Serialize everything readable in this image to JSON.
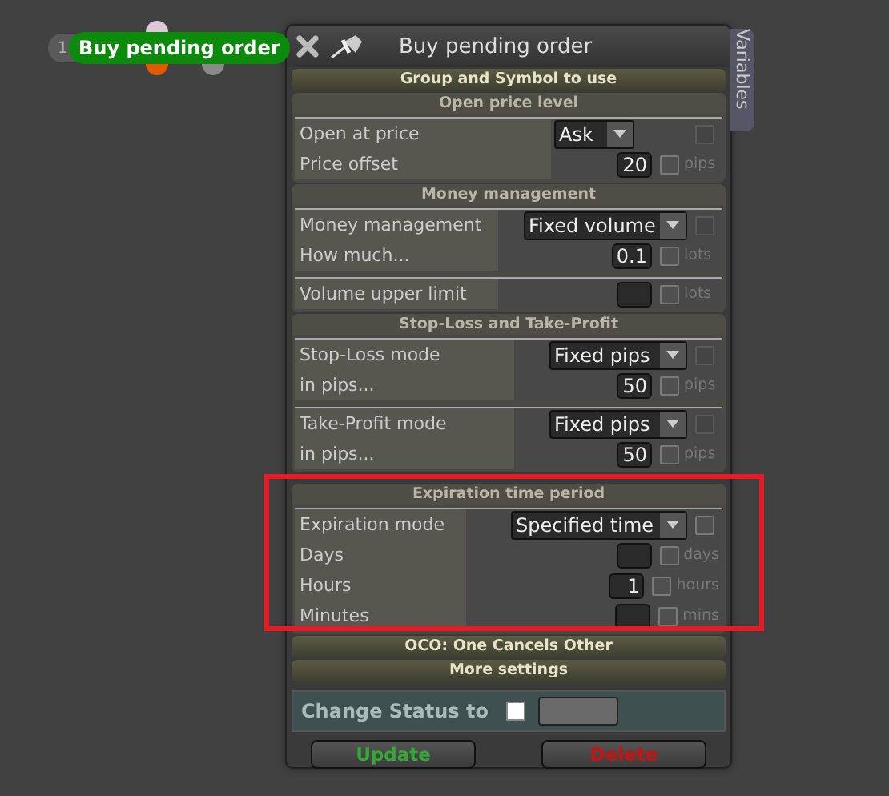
{
  "node": {
    "number": "1",
    "label": "Buy pending order"
  },
  "window": {
    "title": "Buy pending order",
    "side_tab": "Variables"
  },
  "groups": [
    {
      "title": "Group and Symbol to use",
      "expanded": false
    },
    {
      "title": "Open price level",
      "expanded": true,
      "blocks": [
        [
          {
            "kind": "select",
            "label": "Open at price",
            "value": "Ask",
            "checked": false,
            "disabled": true
          },
          {
            "kind": "number",
            "label": "Price offset",
            "value": "20",
            "unit": "pips",
            "checked": false
          }
        ]
      ]
    },
    {
      "title": "Money management",
      "expanded": true,
      "blocks": [
        [
          {
            "kind": "select",
            "label": "Money management",
            "value": "Fixed volume",
            "checked": false,
            "disabled": true
          },
          {
            "kind": "number",
            "label": "How much...",
            "value": "0.1",
            "unit": "lots",
            "checked": false
          }
        ],
        [
          {
            "kind": "number",
            "label": "Volume upper limit",
            "unit": "lots",
            "checked": false
          }
        ]
      ]
    },
    {
      "title": "Stop-Loss and Take-Profit",
      "expanded": true,
      "blocks": [
        [
          {
            "kind": "select",
            "label": "Stop-Loss mode",
            "value": "Fixed pips",
            "checked": false,
            "disabled": true
          },
          {
            "kind": "number",
            "label": "in pips...",
            "value": "50",
            "unit": "pips",
            "checked": false
          }
        ],
        [
          {
            "kind": "select",
            "label": "Take-Profit mode",
            "value": "Fixed pips",
            "checked": false,
            "disabled": true
          },
          {
            "kind": "number",
            "label": "in pips...",
            "value": "50",
            "unit": "pips",
            "checked": false
          }
        ]
      ]
    },
    {
      "title": "Expiration time period",
      "expanded": true,
      "blocks": [
        [
          {
            "kind": "select",
            "label": "Expiration mode",
            "value": "Specified time",
            "checked": false,
            "disabled": false
          },
          {
            "kind": "number",
            "label": "Days",
            "unit": "days",
            "checked": false
          },
          {
            "kind": "number",
            "label": "Hours",
            "value": "1",
            "unit": "hours",
            "checked": false
          },
          {
            "kind": "number",
            "label": "Minutes",
            "unit": "mins",
            "checked": false
          }
        ]
      ]
    },
    {
      "title": "OCO: One Cancels Other",
      "expanded": false
    },
    {
      "title": "More settings",
      "expanded": false
    }
  ],
  "status": {
    "label": "Change Status to",
    "checked": false
  },
  "buttons": [
    {
      "label": "Update",
      "kind": "update"
    },
    {
      "label": "Delete",
      "kind": "delete"
    }
  ]
}
